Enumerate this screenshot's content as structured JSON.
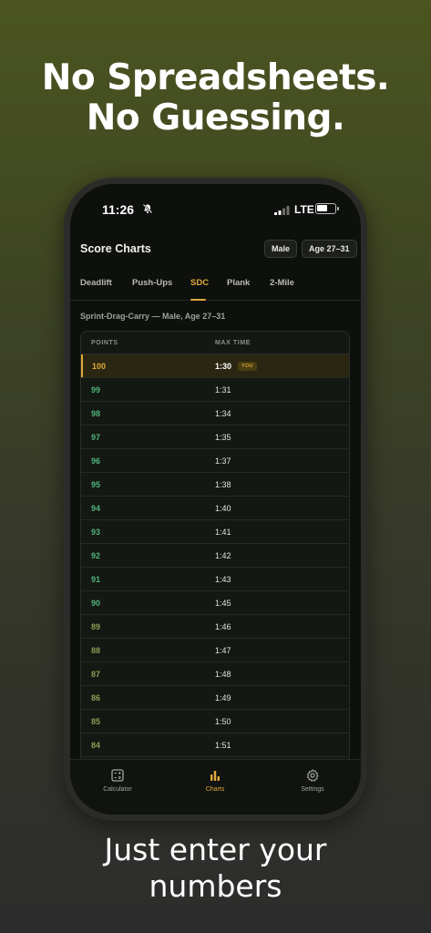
{
  "promo": {
    "headline_line1": "No Spreadsheets.",
    "headline_line2": "No Guessing.",
    "subline_line1": "Just enter your",
    "subline_line2": "numbers"
  },
  "status_bar": {
    "time": "11:26",
    "network": "LTE"
  },
  "header": {
    "title": "Score Charts",
    "sex_filter": "Male",
    "age_filter": "Age 27–31"
  },
  "tabs": [
    {
      "label": "Deadlift",
      "active": false
    },
    {
      "label": "Push-Ups",
      "active": false
    },
    {
      "label": "SDC",
      "active": true
    },
    {
      "label": "Plank",
      "active": false
    },
    {
      "label": "2-Mile",
      "active": false
    }
  ],
  "section_label": "Sprint-Drag-Carry — Male, Age 27–31",
  "table": {
    "columns": [
      "POINTS",
      "MAX TIME"
    ],
    "you_badge": "YOU",
    "rows": [
      {
        "points": "100",
        "time": "1:30",
        "you": true
      },
      {
        "points": "99",
        "time": "1:31"
      },
      {
        "points": "98",
        "time": "1:34"
      },
      {
        "points": "97",
        "time": "1:35"
      },
      {
        "points": "96",
        "time": "1:37"
      },
      {
        "points": "95",
        "time": "1:38"
      },
      {
        "points": "94",
        "time": "1:40"
      },
      {
        "points": "93",
        "time": "1:41"
      },
      {
        "points": "92",
        "time": "1:42"
      },
      {
        "points": "91",
        "time": "1:43"
      },
      {
        "points": "90",
        "time": "1:45"
      },
      {
        "points": "89",
        "time": "1:46"
      },
      {
        "points": "88",
        "time": "1:47"
      },
      {
        "points": "87",
        "time": "1:48"
      },
      {
        "points": "86",
        "time": "1:49"
      },
      {
        "points": "85",
        "time": "1:50"
      },
      {
        "points": "84",
        "time": "1:51"
      }
    ]
  },
  "bottom_nav": [
    {
      "label": "Calculator",
      "icon": "calculator-icon",
      "active": false
    },
    {
      "label": "Charts",
      "icon": "bar-chart-icon",
      "active": true
    },
    {
      "label": "Settings",
      "icon": "gear-icon",
      "active": false
    }
  ],
  "colors": {
    "accent": "#e0a93a",
    "points_green": "#4fb37a",
    "points_olive": "#8f9a52"
  }
}
